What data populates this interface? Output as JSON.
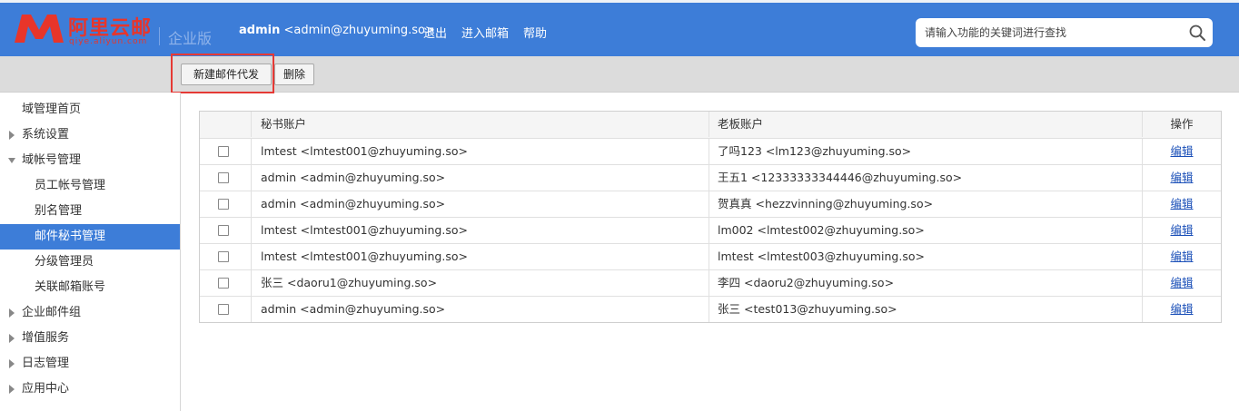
{
  "colors": {
    "header_bg": "#3d7dd8",
    "logo_red": "#e8352a",
    "highlight_border": "#e53935",
    "active_nav": "#3d7dd8"
  },
  "header": {
    "logo_cn": "阿里云邮",
    "logo_en": "qiye.aliyun.com",
    "edition": "企业版",
    "user_name": "admin",
    "user_email": "<admin@zhuyuming.so>",
    "links": [
      "退出",
      "进入邮箱",
      "帮助"
    ],
    "search_placeholder": "请输入功能的关键词进行查找"
  },
  "toolbar": {
    "new_label": "新建邮件代发",
    "delete_label": "删除"
  },
  "sidebar": {
    "items": [
      {
        "label": "域管理首页",
        "icon": ""
      },
      {
        "label": "系统设置",
        "icon": "chevron-right-icon"
      },
      {
        "label": "域帐号管理",
        "icon": "chevron-down-icon"
      },
      {
        "label": "员工帐号管理",
        "icon": ""
      },
      {
        "label": "别名管理",
        "icon": ""
      },
      {
        "label": "邮件秘书管理",
        "icon": "",
        "active": true
      },
      {
        "label": "分级管理员",
        "icon": ""
      },
      {
        "label": "关联邮箱账号",
        "icon": ""
      },
      {
        "label": "企业邮件组",
        "icon": "chevron-right-icon"
      },
      {
        "label": "增值服务",
        "icon": "chevron-right-icon"
      },
      {
        "label": "日志管理",
        "icon": "chevron-right-icon"
      },
      {
        "label": "应用中心",
        "icon": "chevron-right-icon"
      }
    ]
  },
  "table": {
    "headers": {
      "secretary": "秘书账户",
      "boss": "老板账户",
      "op": "操作"
    },
    "rows": [
      {
        "secretary": "lmtest <lmtest001@zhuyuming.so>",
        "boss": "了吗123 <lm123@zhuyuming.so>",
        "op": "编辑"
      },
      {
        "secretary": "admin <admin@zhuyuming.so>",
        "boss": "王五1 <12333333344446@zhuyuming.so>",
        "op": "编辑"
      },
      {
        "secretary": "admin <admin@zhuyuming.so>",
        "boss": "贺真真 <hezzvinning@zhuyuming.so>",
        "op": "编辑"
      },
      {
        "secretary": "lmtest <lmtest001@zhuyuming.so>",
        "boss": "lm002 <lmtest002@zhuyuming.so>",
        "op": "编辑"
      },
      {
        "secretary": "lmtest <lmtest001@zhuyuming.so>",
        "boss": "lmtest <lmtest003@zhuyuming.so>",
        "op": "编辑"
      },
      {
        "secretary": "张三 <daoru1@zhuyuming.so>",
        "boss": "李四 <daoru2@zhuyuming.so>",
        "op": "编辑"
      },
      {
        "secretary": "admin <admin@zhuyuming.so>",
        "boss": "张三 <test013@zhuyuming.so>",
        "op": "编辑"
      }
    ]
  }
}
